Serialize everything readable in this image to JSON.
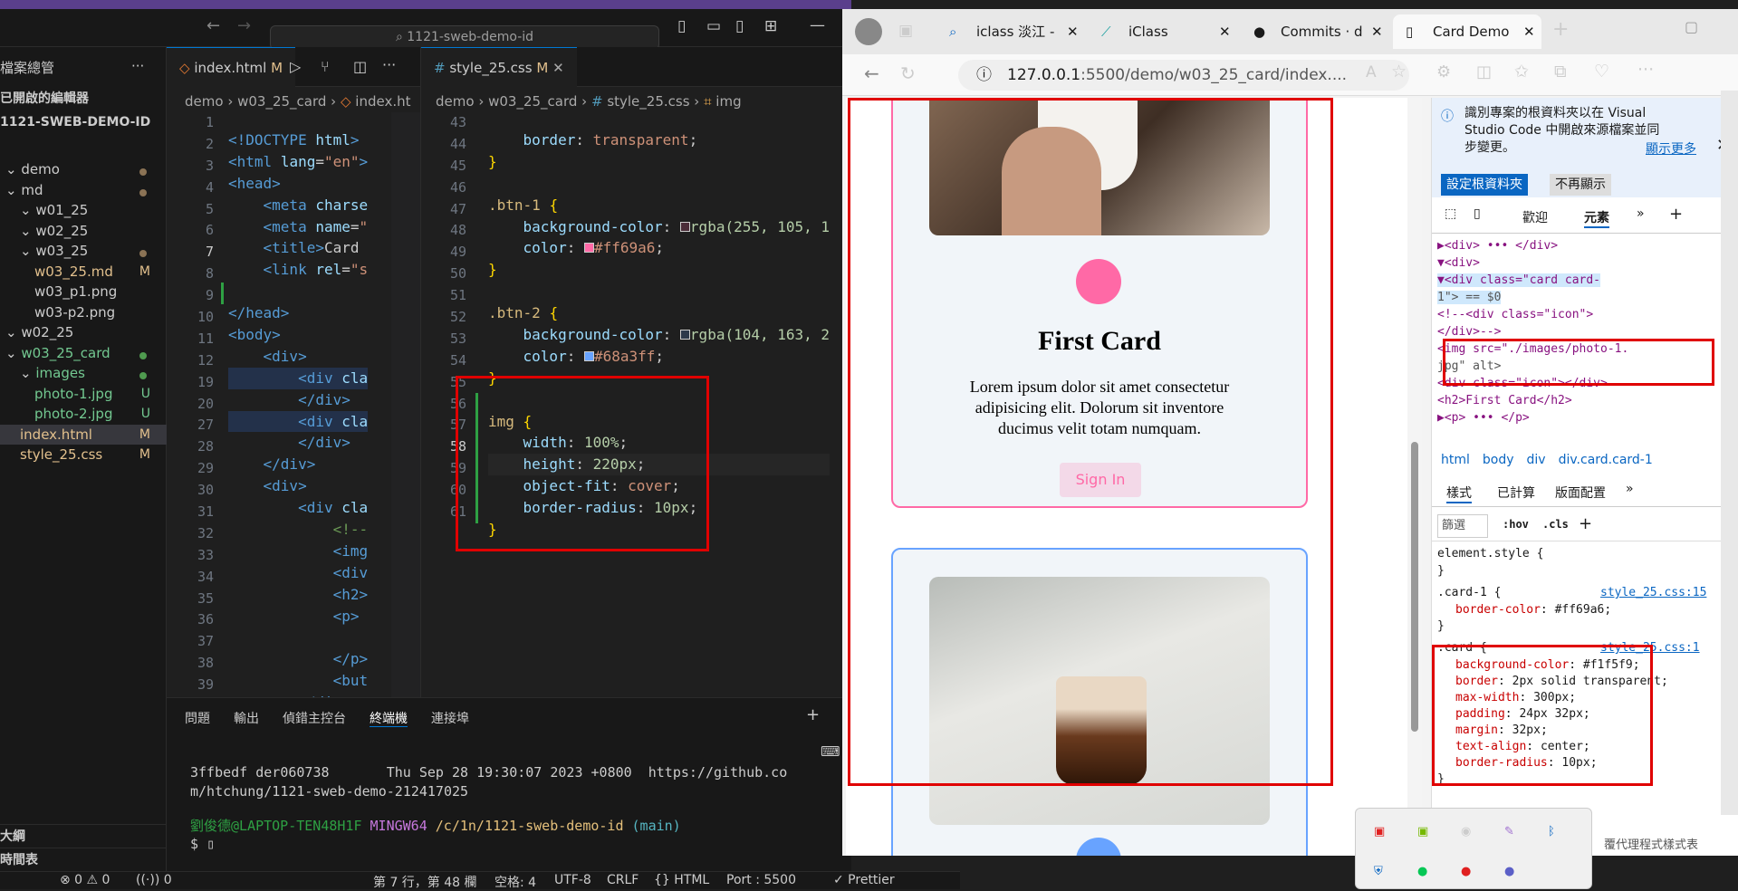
{
  "vscode": {
    "search_placeholder": "1121-sweb-demo-id",
    "explorer_title": "檔案總管",
    "open_editors": "已開啟的編輯器",
    "workspace": "1121-SWEB-DEMO-ID",
    "tree": [
      {
        "label": "demo",
        "badge": "",
        "dot": "#8b7355"
      },
      {
        "label": "md",
        "badge": "",
        "dot": "#8b7355"
      },
      {
        "label": "w01_25",
        "badge": "",
        "dot": ""
      },
      {
        "label": "w02_25",
        "badge": "",
        "dot": ""
      },
      {
        "label": "w03_25",
        "badge": "",
        "dot": "#8b7355"
      },
      {
        "label": "w03_25.md",
        "badge": "M",
        "dot": ""
      },
      {
        "label": "w03_p1.png",
        "badge": "",
        "dot": ""
      },
      {
        "label": "w03-p2.png",
        "badge": "",
        "dot": ""
      },
      {
        "label": "w02_25",
        "badge": "",
        "dot": ""
      },
      {
        "label": "w03_25_card",
        "badge": "",
        "dot": "#4f9a4f"
      },
      {
        "label": "images",
        "badge": "",
        "dot": "#4f9a4f"
      },
      {
        "label": "photo-1.jpg",
        "badge": "U",
        "dot": ""
      },
      {
        "label": "photo-2.jpg",
        "badge": "U",
        "dot": ""
      },
      {
        "label": "index.html",
        "badge": "M",
        "dot": ""
      },
      {
        "label": "style_25.css",
        "badge": "M",
        "dot": ""
      }
    ],
    "outline": "大綱",
    "timeline": "時間表",
    "tab_html": "index.html",
    "tab_html_badge": "M",
    "tab_css": "style_25.css",
    "tab_css_badge": "M",
    "crumb_html": [
      "demo",
      "w03_25_card",
      "index.ht"
    ],
    "crumb_css": [
      "demo",
      "w03_25_card",
      "style_25.css",
      "img"
    ],
    "html_lines": [
      "1",
      "2",
      "3",
      "4",
      "5",
      "6",
      "7",
      "8",
      "9",
      "10",
      "11",
      "12",
      "19",
      "20",
      "27",
      "28",
      "29",
      "30",
      "31",
      "32",
      "33",
      "34",
      "35",
      "36",
      "37",
      "38",
      "39"
    ],
    "css_lines": [
      "43",
      "44",
      "45",
      "46",
      "47",
      "48",
      "49",
      "50",
      "51",
      "52",
      "53",
      "54",
      "55",
      "56",
      "57",
      "58",
      "59",
      "60",
      "61"
    ],
    "panel_tabs": [
      "問題",
      "輸出",
      "偵錯主控台",
      "終端機",
      "連接埠"
    ],
    "terminal": [
      "3ffbedf der060738       Thu Sep 28 19:30:07 2023 +0800  https://github.co",
      "m/htchung/1121-sweb-demo-212417025",
      ""
    ],
    "prompt_user": "劉俊德@LAPTOP-TEN48H1F",
    "prompt_env": "MINGW64",
    "prompt_path": "/c/1n/1121-sweb-demo-id",
    "prompt_branch": "(main)",
    "status": {
      "errors": "⊗ 0 ⚠ 0",
      "ports": "0",
      "position": "第 7 行，第 48 欄",
      "spaces": "空格: 4",
      "encoding": "UTF-8",
      "eol": "CRLF",
      "lang": "{} HTML",
      "port": "Port : 5500",
      "prettier": "✓ Prettier"
    }
  },
  "edge": {
    "tabs": [
      "iclass 淡江 -",
      "iClass",
      "Commits · d",
      "Card Demo"
    ],
    "url_host": "127.0.0.1",
    "url_rest": ":5500/demo/w03_25_card/index....",
    "cards": [
      {
        "title": "First Card",
        "text": "Lorem ipsum dolor sit amet consectetur adipisicing elit. Dolorum sit inventore ducimus velit totam numquam.",
        "button": "Sign In",
        "accent": "#ff69a6"
      },
      {
        "accent": "#68a3ff"
      }
    ],
    "devtools": {
      "infobar": "識別專案的根資料夾以在 Visual Studio Code 中開啟來源檔案並同步變更。",
      "learn_more": "顯示更多",
      "set_root": "設定根資料夾",
      "dont_show": "不再顯示",
      "tabs": [
        "歡迎",
        "元素"
      ],
      "elements": [
        "▶<div> ••• </div>",
        "▼<div>",
        "  ▼<div class=\"card card-",
        "     1\"> == $0",
        "     <!--<div class=\"icon\">",
        "     </div>-->",
        "     <img src=\"./images/photo-1.",
        "     jpg\" alt>",
        "     <div class=\"icon\"></div>",
        "     <h2>First Card</h2>",
        "    ▶<p> ••• </p>"
      ],
      "path": [
        "html",
        "body",
        "div",
        "div.card.card-1"
      ],
      "style_tabs": [
        "樣式",
        "已計算",
        "版面配置"
      ],
      "filter": "篩選",
      "hov": ":hov",
      "cls": ".cls",
      "rules": [
        {
          "sel": "element.style {",
          "src": "",
          "props": []
        },
        {
          "sel": ".card-1 {",
          "src": "style_25.css:15",
          "props": [
            [
              "border-color",
              "#ff69a6"
            ]
          ]
        },
        {
          "sel": ".card {",
          "src": "style_25.css:1",
          "props": [
            [
              "background-color",
              "#f1f5f9"
            ],
            [
              "border",
              "2px solid transparent"
            ],
            [
              "max-width",
              "300px"
            ],
            [
              "padding",
              "24px 32px"
            ],
            [
              "margin",
              "32px"
            ],
            [
              "text-align",
              "center"
            ],
            [
              "border-radius",
              "10px"
            ]
          ]
        }
      ],
      "footer": "覆代理程式樣式表"
    }
  }
}
